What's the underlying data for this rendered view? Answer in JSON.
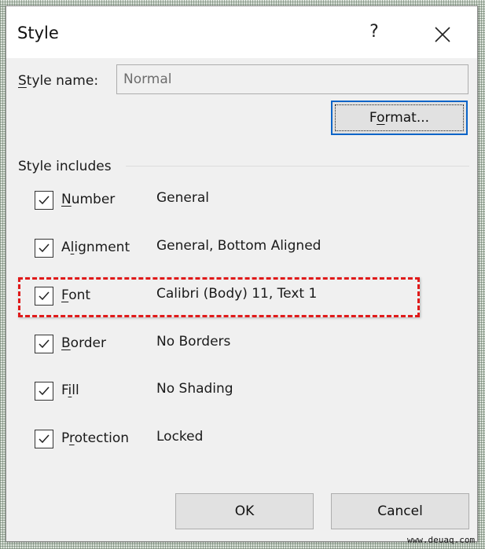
{
  "dialog": {
    "title": "Style",
    "help_label": "?",
    "close_icon": "close-icon"
  },
  "style_name": {
    "label_mnemonic": "S",
    "label_rest": "tyle name:",
    "value": "Normal"
  },
  "format_button": {
    "pre": "F",
    "mnemonic": "o",
    "post": "rmat..."
  },
  "style_includes": {
    "label": "Style includes",
    "items": [
      {
        "pre": "",
        "mnemonic": "N",
        "post": "umber",
        "value": "General",
        "checked": true
      },
      {
        "pre": "A",
        "mnemonic": "l",
        "post": "ignment",
        "value": "General, Bottom Aligned",
        "checked": true
      },
      {
        "pre": "",
        "mnemonic": "F",
        "post": "ont",
        "value": "Calibri (Body) 11, Text 1",
        "checked": true,
        "highlighted": true
      },
      {
        "pre": "",
        "mnemonic": "B",
        "post": "order",
        "value": "No Borders",
        "checked": true
      },
      {
        "pre": "F",
        "mnemonic": "i",
        "post": "ll",
        "value": "No Shading",
        "checked": true
      },
      {
        "pre": "P",
        "mnemonic": "r",
        "post": "otection",
        "value": "Locked",
        "checked": true
      }
    ]
  },
  "buttons": {
    "ok": "OK",
    "cancel": "Cancel"
  },
  "colors": {
    "highlight": "#e01a1a",
    "focus": "#0a64c8"
  },
  "watermark": "www.deuaq.com"
}
